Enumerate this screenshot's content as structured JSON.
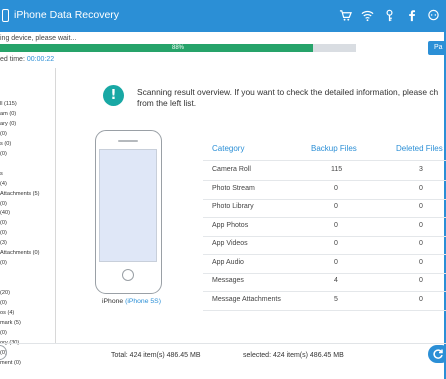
{
  "window": {
    "title": "iPhone Data Recovery"
  },
  "title_icons": [
    "cart-icon",
    "wifi-icon",
    "key-icon",
    "facebook-icon",
    "chat-icon"
  ],
  "scan": {
    "status": "ing device, please wait...",
    "progress_percent": 88,
    "progress_label": "88%",
    "pause_label": "Pa",
    "elapsed_label": "ed time: ",
    "elapsed_value": "00:00:22"
  },
  "sidebar": {
    "items": [
      "ll (115)",
      "am (0)",
      "ary (0)",
      "(0)",
      "s (0)",
      "(0)",
      "",
      "s",
      "(4)",
      "Attachments (5)",
      "(0)",
      "(40)",
      "(0)",
      "(0)",
      "(3)",
      "Attachments (0)",
      "(0)",
      "",
      "",
      "(20)",
      "(0)",
      "os (4)",
      "mark (5)",
      "(0)",
      "ory (30)",
      "(0)",
      "ment (0)"
    ]
  },
  "overview": {
    "message_line1": "Scanning result overview. If you want to check the detailed information, please ch",
    "message_line2": "from the left list.",
    "device_label": "iPhone",
    "device_model": "(iPhone 5S)"
  },
  "table": {
    "headers": {
      "category": "Category",
      "backup": "Backup Files",
      "deleted": "Deleted Files"
    },
    "rows": [
      {
        "category": "Camera Roll",
        "backup": "115",
        "deleted": "3"
      },
      {
        "category": "Photo Stream",
        "backup": "0",
        "deleted": "0"
      },
      {
        "category": "Photo Library",
        "backup": "0",
        "deleted": "0"
      },
      {
        "category": "App Photos",
        "backup": "0",
        "deleted": "0"
      },
      {
        "category": "App Videos",
        "backup": "0",
        "deleted": "0"
      },
      {
        "category": "App Audio",
        "backup": "0",
        "deleted": "0"
      },
      {
        "category": "Messages",
        "backup": "4",
        "deleted": "0"
      },
      {
        "category": "Message Attachments",
        "backup": "5",
        "deleted": "0"
      }
    ]
  },
  "footer": {
    "total": "Total: 424 item(s) 486.45 MB",
    "selected": "selected: 424 item(s) 486.45 MB"
  },
  "colors": {
    "accent": "#2b8fd6",
    "progress": "#26a36a",
    "info": "#18a8a4"
  }
}
